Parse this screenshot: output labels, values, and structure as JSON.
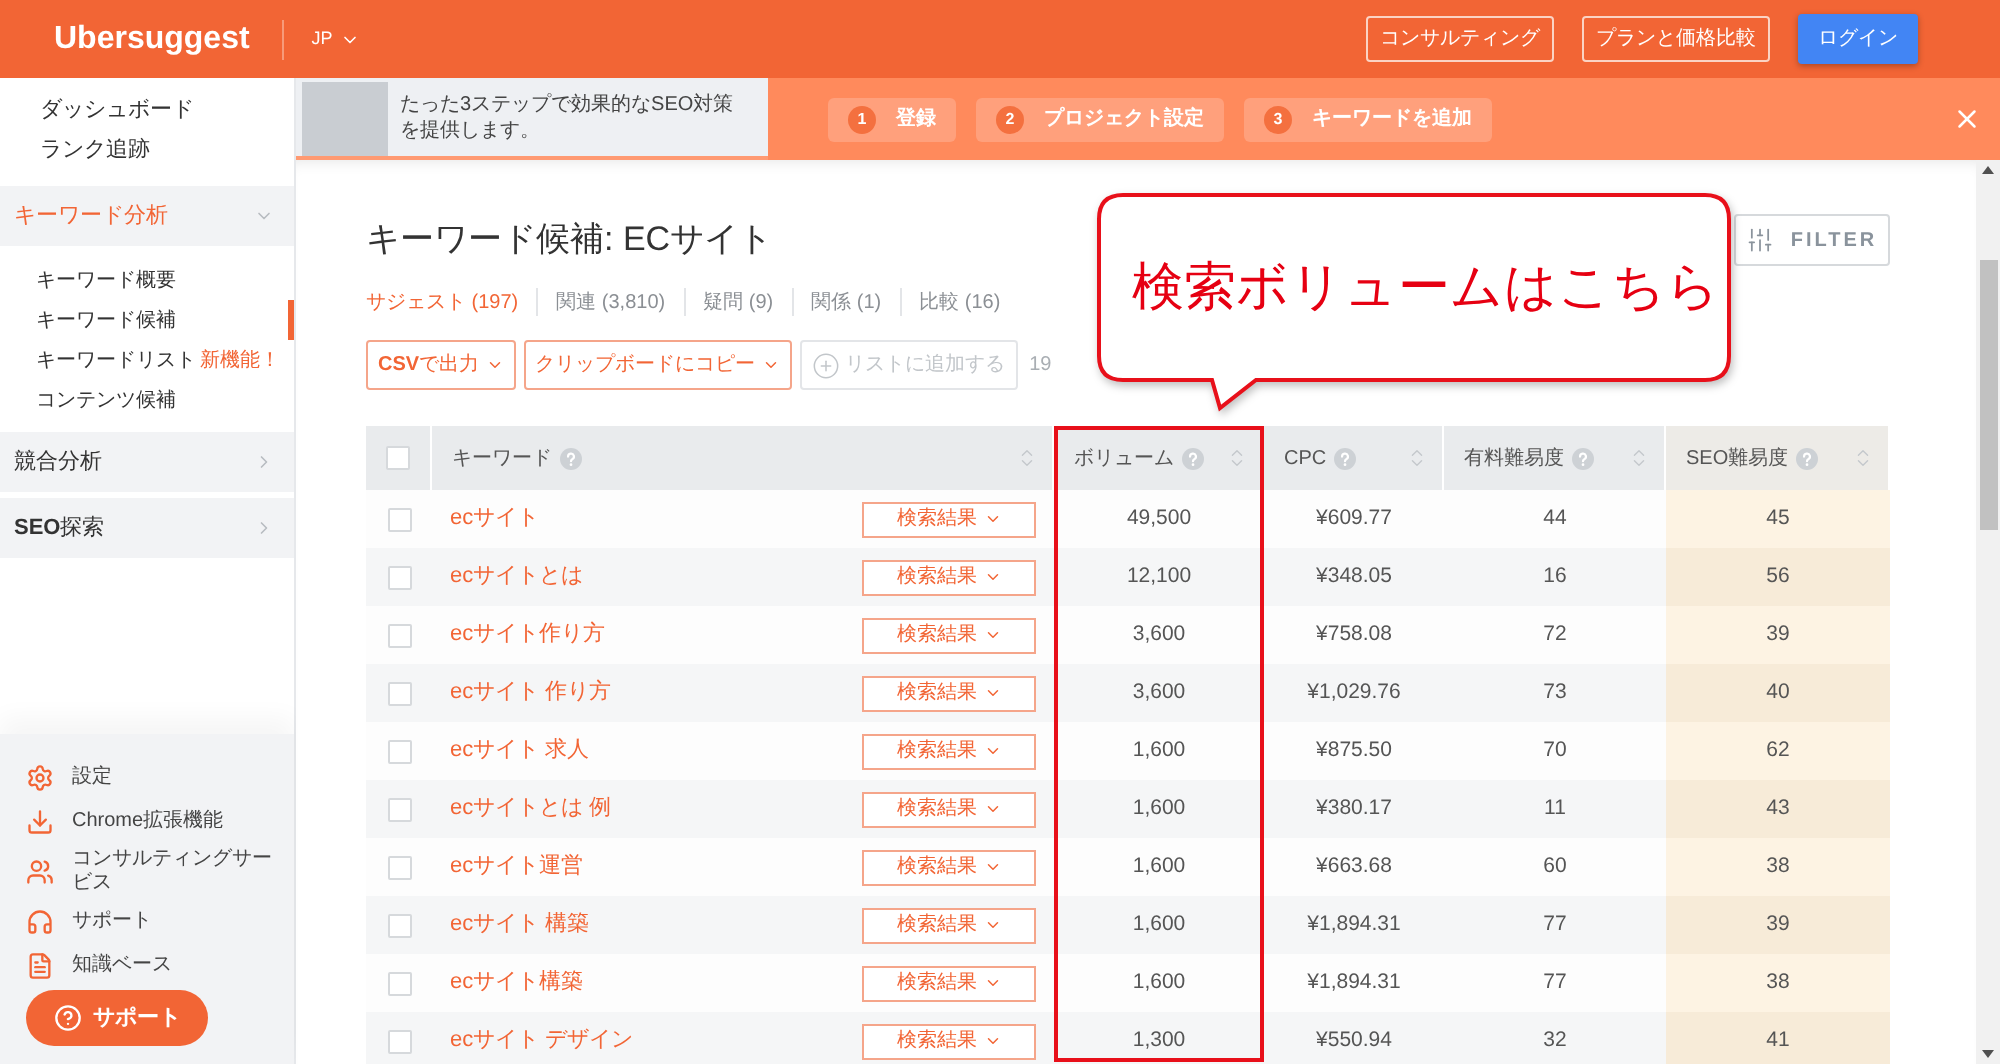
{
  "header": {
    "logo": "Ubersuggest",
    "language": "JP",
    "buttons": [
      {
        "label": "コンサルティング",
        "kind": "outline"
      },
      {
        "label": "プランと価格比較",
        "kind": "outline"
      },
      {
        "label": "ログイン",
        "kind": "primary"
      }
    ]
  },
  "sidebar": {
    "links": [
      {
        "label": "ダッシュボード"
      },
      {
        "label": "ランク追跡"
      }
    ],
    "sections": [
      {
        "label": "キーワード分析",
        "expanded": true,
        "children": [
          {
            "label": "キーワード概要",
            "selected": false
          },
          {
            "label": "キーワード候補",
            "selected": true
          },
          {
            "label": "キーワードリスト",
            "badge": "新機能！",
            "selected": false
          },
          {
            "label": "コンテンツ候補",
            "selected": false
          }
        ]
      },
      {
        "label": "競合分析",
        "expanded": false
      },
      {
        "label": "**SEO**探索",
        "expanded": false
      }
    ],
    "footer_links": [
      {
        "label": "設定"
      },
      {
        "label": "Chrome拡張機能"
      },
      {
        "label": "コンサルティングサービス"
      },
      {
        "label": "サポート"
      },
      {
        "label": "知識ベース"
      }
    ],
    "support_button": "サポート"
  },
  "banner": {
    "text": "たった3ステップで効果的なSEO対策を提供します。",
    "steps": [
      {
        "number": "1",
        "label": "登録"
      },
      {
        "number": "2",
        "label": "プロジェクト設定"
      },
      {
        "number": "3",
        "label": "キーワードを追加"
      }
    ]
  },
  "main": {
    "title": "キーワード候補: ECサイト",
    "filter_button": "FILTER",
    "tabs": [
      {
        "label": "サジェスト (197)",
        "selected": true
      },
      {
        "label": "関連 (3,810)",
        "selected": false
      },
      {
        "label": "疑問 (9)",
        "selected": false
      },
      {
        "label": "関係 (1)",
        "selected": false
      },
      {
        "label": "比較 (16)",
        "selected": false
      }
    ],
    "toolbar": {
      "buttons": [
        {
          "label": "**CSV**で出力",
          "kind": "dropdown",
          "disabled": false
        },
        {
          "label": "クリップボードにコピー",
          "kind": "dropdown",
          "disabled": false
        },
        {
          "label": "リストに追加する",
          "kind": "add",
          "disabled": true
        }
      ],
      "partial_text": "19"
    }
  },
  "table": {
    "header_checked": false,
    "columns": [
      {
        "label": "キーワード"
      },
      {
        "label": "ボリューム"
      },
      {
        "label": "CPC"
      },
      {
        "label": "有料難易度"
      },
      {
        "label": "SEO難易度"
      }
    ],
    "rows": [
      {
        "keyword": "ecサイト",
        "action": "検索結果",
        "volume": "49,500",
        "cpc": "¥609.77",
        "paid_difficulty": "44",
        "seo_difficulty": "45",
        "checked": false
      },
      {
        "keyword": "ecサイトとは",
        "action": "検索結果",
        "volume": "12,100",
        "cpc": "¥348.05",
        "paid_difficulty": "16",
        "seo_difficulty": "56",
        "checked": false
      },
      {
        "keyword": "ecサイト作り方",
        "action": "検索結果",
        "volume": "3,600",
        "cpc": "¥758.08",
        "paid_difficulty": "72",
        "seo_difficulty": "39",
        "checked": false
      },
      {
        "keyword": "ecサイト 作り方",
        "action": "検索結果",
        "volume": "3,600",
        "cpc": "¥1,029.76",
        "paid_difficulty": "73",
        "seo_difficulty": "40",
        "checked": false
      },
      {
        "keyword": "ecサイト 求人",
        "action": "検索結果",
        "volume": "1,600",
        "cpc": "¥875.50",
        "paid_difficulty": "70",
        "seo_difficulty": "62",
        "checked": false
      },
      {
        "keyword": "ecサイトとは 例",
        "action": "検索結果",
        "volume": "1,600",
        "cpc": "¥380.17",
        "paid_difficulty": "11",
        "seo_difficulty": "43",
        "checked": false
      },
      {
        "keyword": "ecサイト運営",
        "action": "検索結果",
        "volume": "1,600",
        "cpc": "¥663.68",
        "paid_difficulty": "60",
        "seo_difficulty": "38",
        "checked": false
      },
      {
        "keyword": "ecサイト 構築",
        "action": "検索結果",
        "volume": "1,600",
        "cpc": "¥1,894.31",
        "paid_difficulty": "77",
        "seo_difficulty": "39",
        "checked": false
      },
      {
        "keyword": "ecサイト構築",
        "action": "検索結果",
        "volume": "1,600",
        "cpc": "¥1,894.31",
        "paid_difficulty": "77",
        "seo_difficulty": "38",
        "checked": false
      },
      {
        "keyword": "ecサイト デザイン",
        "action": "検索結果",
        "volume": "1,300",
        "cpc": "¥550.94",
        "paid_difficulty": "32",
        "seo_difficulty": "41",
        "checked": false
      }
    ]
  },
  "callout": {
    "text": "検索ボリュームはこちら"
  }
}
